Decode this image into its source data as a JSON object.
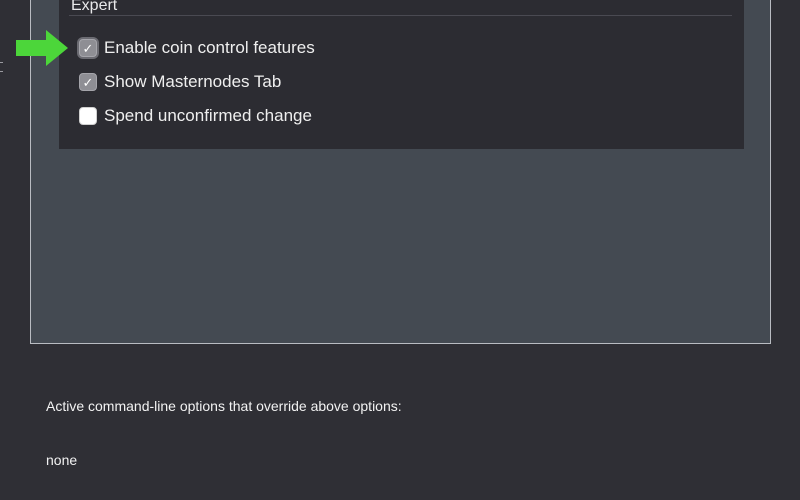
{
  "group": {
    "title": "Expert"
  },
  "options": [
    {
      "label": "Enable coin control features",
      "checked": true
    },
    {
      "label": "Show Masternodes Tab",
      "checked": true
    },
    {
      "label": "Spend unconfirmed change",
      "checked": false
    }
  ],
  "overrides": {
    "label": "Active command-line options that override above options:",
    "value": "none"
  },
  "icons": {
    "arrow": "right-arrow-icon",
    "check": "checkmark-icon"
  },
  "colors": {
    "arrow": "#4cd63a",
    "panel": "#444a52",
    "groupbox": "#2c2c32",
    "background": "#2f2f35"
  }
}
